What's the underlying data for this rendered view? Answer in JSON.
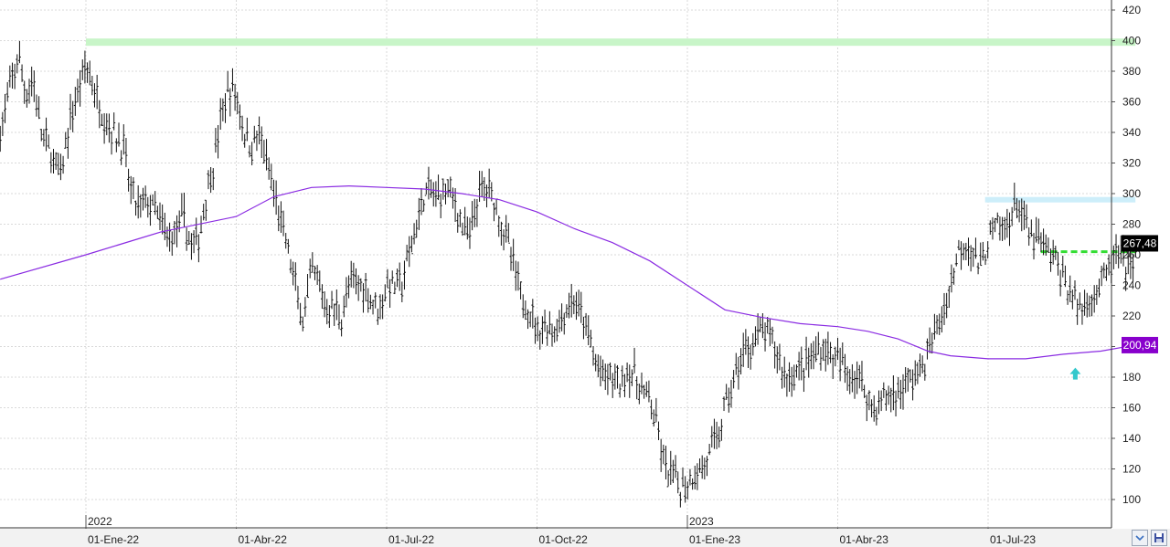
{
  "chart_data": {
    "type": "ohlc",
    "y_ticks": [
      100,
      120,
      140,
      160,
      180,
      200,
      220,
      240,
      260,
      280,
      300,
      320,
      340,
      360,
      380,
      400,
      420
    ],
    "ylim": [
      87,
      422
    ],
    "grid": true,
    "x_ticks": [
      {
        "label": "01-Ene-22",
        "pos": 0
      },
      {
        "label": "01-Abr-22",
        "pos": 1
      },
      {
        "label": "01-Jul-22",
        "pos": 2
      },
      {
        "label": "01-Oct-22",
        "pos": 3
      },
      {
        "label": "01-Ene-23",
        "pos": 4
      },
      {
        "label": "01-Abr-23",
        "pos": 5
      },
      {
        "label": "01-Jul-23",
        "pos": 6
      }
    ],
    "year_labels": [
      {
        "label": "2022",
        "pos": 0
      },
      {
        "label": "2023",
        "pos": 4
      }
    ],
    "price_path": [
      [
        -0.57,
        340
      ],
      [
        -0.5,
        370
      ],
      [
        -0.45,
        390
      ],
      [
        -0.4,
        365
      ],
      [
        -0.35,
        375
      ],
      [
        -0.3,
        340
      ],
      [
        -0.25,
        330
      ],
      [
        -0.17,
        310
      ],
      [
        -0.1,
        350
      ],
      [
        0.0,
        385
      ],
      [
        0.08,
        360
      ],
      [
        0.15,
        345
      ],
      [
        0.25,
        330
      ],
      [
        0.3,
        300
      ],
      [
        0.35,
        290
      ],
      [
        0.4,
        295
      ],
      [
        0.45,
        290
      ],
      [
        0.5,
        280
      ],
      [
        0.55,
        270
      ],
      [
        0.6,
        275
      ],
      [
        0.65,
        285
      ],
      [
        0.7,
        265
      ],
      [
        0.75,
        270
      ],
      [
        0.8,
        300
      ],
      [
        0.85,
        320
      ],
      [
        0.9,
        350
      ],
      [
        0.95,
        368
      ],
      [
        1.0,
        365
      ],
      [
        1.05,
        340
      ],
      [
        1.1,
        330
      ],
      [
        1.15,
        340
      ],
      [
        1.2,
        320
      ],
      [
        1.25,
        300
      ],
      [
        1.3,
        280
      ],
      [
        1.35,
        260
      ],
      [
        1.4,
        235
      ],
      [
        1.45,
        215
      ],
      [
        1.5,
        250
      ],
      [
        1.55,
        240
      ],
      [
        1.6,
        225
      ],
      [
        1.65,
        225
      ],
      [
        1.7,
        220
      ],
      [
        1.75,
        240
      ],
      [
        1.8,
        240
      ],
      [
        1.85,
        240
      ],
      [
        1.9,
        230
      ],
      [
        1.95,
        225
      ],
      [
        2.0,
        240
      ],
      [
        2.1,
        240
      ],
      [
        2.15,
        260
      ],
      [
        2.2,
        280
      ],
      [
        2.25,
        300
      ],
      [
        2.3,
        300
      ],
      [
        2.35,
        298
      ],
      [
        2.4,
        305
      ],
      [
        2.45,
        295
      ],
      [
        2.5,
        280
      ],
      [
        2.55,
        270
      ],
      [
        2.6,
        295
      ],
      [
        2.65,
        305
      ],
      [
        2.7,
        300
      ],
      [
        2.75,
        285
      ],
      [
        2.8,
        270
      ],
      [
        2.85,
        250
      ],
      [
        2.9,
        230
      ],
      [
        2.95,
        225
      ],
      [
        3.0,
        210
      ],
      [
        3.05,
        215
      ],
      [
        3.1,
        210
      ],
      [
        3.15,
        215
      ],
      [
        3.2,
        225
      ],
      [
        3.25,
        230
      ],
      [
        3.3,
        218
      ],
      [
        3.35,
        205
      ],
      [
        3.4,
        185
      ],
      [
        3.45,
        180
      ],
      [
        3.5,
        180
      ],
      [
        3.55,
        175
      ],
      [
        3.6,
        185
      ],
      [
        3.65,
        180
      ],
      [
        3.7,
        170
      ],
      [
        3.75,
        165
      ],
      [
        3.8,
        145
      ],
      [
        3.85,
        120
      ],
      [
        3.9,
        115
      ],
      [
        3.95,
        108
      ],
      [
        4.0,
        110
      ],
      [
        4.05,
        118
      ],
      [
        4.1,
        120
      ],
      [
        4.15,
        130
      ],
      [
        4.2,
        140
      ],
      [
        4.25,
        160
      ],
      [
        4.3,
        175
      ],
      [
        4.35,
        190
      ],
      [
        4.4,
        200
      ],
      [
        4.45,
        205
      ],
      [
        4.5,
        210
      ],
      [
        4.55,
        205
      ],
      [
        4.6,
        195
      ],
      [
        4.65,
        180
      ],
      [
        4.7,
        182
      ],
      [
        4.75,
        185
      ],
      [
        4.8,
        190
      ],
      [
        4.85,
        195
      ],
      [
        4.9,
        200
      ],
      [
        4.95,
        195
      ],
      [
        5.0,
        190
      ],
      [
        5.05,
        185
      ],
      [
        5.1,
        182
      ],
      [
        5.15,
        180
      ],
      [
        5.2,
        165
      ],
      [
        5.25,
        160
      ],
      [
        5.3,
        165
      ],
      [
        5.35,
        168
      ],
      [
        5.4,
        170
      ],
      [
        5.45,
        175
      ],
      [
        5.5,
        180
      ],
      [
        5.55,
        185
      ],
      [
        5.6,
        195
      ],
      [
        5.65,
        210
      ],
      [
        5.7,
        220
      ],
      [
        5.75,
        240
      ],
      [
        5.8,
        262
      ],
      [
        5.85,
        270
      ],
      [
        5.9,
        262
      ],
      [
        5.95,
        250
      ],
      [
        6.0,
        270
      ],
      [
        6.05,
        278
      ],
      [
        6.1,
        275
      ],
      [
        6.15,
        285
      ],
      [
        6.2,
        295
      ],
      [
        6.25,
        278
      ],
      [
        6.3,
        270
      ],
      [
        6.35,
        268
      ],
      [
        6.4,
        262
      ],
      [
        6.45,
        255
      ],
      [
        6.5,
        245
      ],
      [
        6.55,
        235
      ],
      [
        6.6,
        225
      ],
      [
        6.65,
        228
      ],
      [
        6.7,
        235
      ],
      [
        6.75,
        240
      ],
      [
        6.8,
        250
      ],
      [
        6.85,
        260
      ],
      [
        6.9,
        255
      ],
      [
        6.95,
        250
      ],
      [
        6.98,
        268
      ]
    ],
    "moving_average": [
      [
        -0.57,
        244
      ],
      [
        0.0,
        260
      ],
      [
        0.5,
        275
      ],
      [
        1.0,
        285
      ],
      [
        1.25,
        298
      ],
      [
        1.5,
        304
      ],
      [
        1.75,
        305
      ],
      [
        2.0,
        304
      ],
      [
        2.25,
        303
      ],
      [
        2.5,
        300
      ],
      [
        2.75,
        296
      ],
      [
        3.0,
        288
      ],
      [
        3.25,
        277
      ],
      [
        3.5,
        268
      ],
      [
        3.75,
        256
      ],
      [
        4.0,
        240
      ],
      [
        4.25,
        224
      ],
      [
        4.5,
        219
      ],
      [
        4.75,
        215
      ],
      [
        5.0,
        213
      ],
      [
        5.2,
        210
      ],
      [
        5.4,
        205
      ],
      [
        5.6,
        197
      ],
      [
        5.75,
        194
      ],
      [
        6.0,
        192
      ],
      [
        6.25,
        192
      ],
      [
        6.5,
        195
      ],
      [
        6.75,
        197
      ],
      [
        6.98,
        201
      ]
    ],
    "resistance_line": {
      "value": 399,
      "color": "#c8f5c8",
      "from_pos": 0,
      "to_pos": 6.98
    },
    "upper_band": {
      "value": 296,
      "color": "#cdeefa",
      "from_pos": 5.98,
      "to_pos": 6.98
    },
    "dashed_level": {
      "value": 262,
      "color": "#33dd33",
      "from_pos": 6.35,
      "to_pos": 6.98
    },
    "arrow_marker": {
      "value": 182,
      "pos": 6.58,
      "color": "#33c8cc"
    },
    "last_price": {
      "label": "267,48",
      "value": 267.48,
      "color": "#000000"
    },
    "ma_value": {
      "label": "200,94",
      "value": 200.94,
      "color": "#8800cc"
    },
    "ma_color": "#8a2be2"
  }
}
